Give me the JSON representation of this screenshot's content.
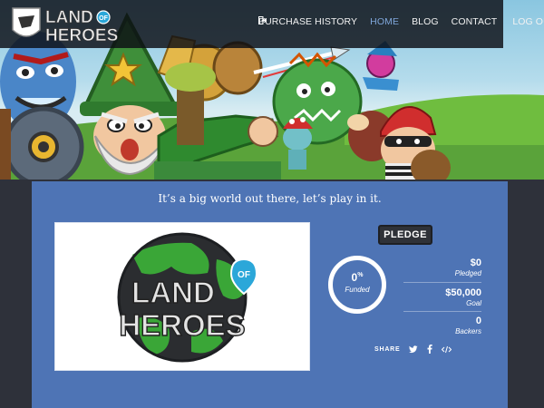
{
  "header": {
    "logo": {
      "line1": "LAND",
      "line2": "HEROES",
      "badge": "OF",
      "icon": "shield-logo-icon"
    },
    "nav": [
      {
        "label": "PURCHASE HISTORY",
        "active": false
      },
      {
        "label": "HOME",
        "active": true
      },
      {
        "label": "BLOG",
        "active": false
      },
      {
        "label": "CONTACT",
        "active": false
      },
      {
        "label": "LOG OUT",
        "active": false,
        "icon": "logout-icon"
      }
    ]
  },
  "hero": {
    "image": "cartoon-heroes-banner"
  },
  "campaign": {
    "tagline": "It’s a big world out there, let’s play in it.",
    "video_logo": {
      "line1": "LAND",
      "line2": "HEROES",
      "badge": "OF"
    },
    "pledge_label": "PLEDGE",
    "funded": {
      "value": "0",
      "unit": "%",
      "label": "Funded",
      "fraction": 0
    },
    "stats": [
      {
        "value": "$0",
        "label": "Pledged"
      },
      {
        "value": "$50,000",
        "label": "Goal"
      },
      {
        "value": "0",
        "label": "Backers"
      }
    ],
    "share": {
      "label": "SHARE",
      "icons": [
        "twitter-icon",
        "facebook-icon",
        "embed-code-icon"
      ]
    }
  },
  "colors": {
    "panel": "#4e74b5",
    "page_bg": "#2e313a",
    "nav_active": "#7fa6da",
    "pledge_button": "#2f3238"
  }
}
